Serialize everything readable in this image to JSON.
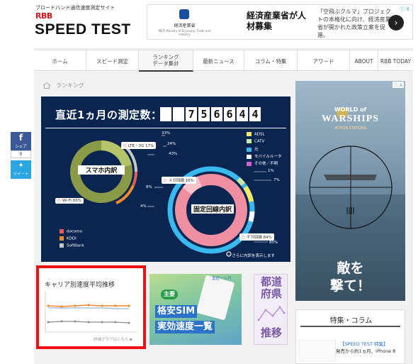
{
  "header": {
    "tagline": "ブロードバンド通信速度測定サイト",
    "logo_rbb": "RBB",
    "logo_speedtest": "SPEED TEST"
  },
  "top_ad": {
    "sponsor": "経済産業省",
    "sponsor_sub": "METI Ministry of Economy, Trade and Industry",
    "headline": "経済産業省が人材募集",
    "body": "「空飛ぶクルマ」プロジェクトの本格化に向け、経済産業省が開かれた政策立案を促進。",
    "close": "ⓘ X"
  },
  "nav": {
    "items": [
      {
        "label": "ホーム"
      },
      {
        "label": "スピード測定"
      },
      {
        "label": "ランキング\nデータ集計"
      },
      {
        "label": "最新ニュース"
      },
      {
        "label": "コラム・特集"
      },
      {
        "label": "アワード"
      },
      {
        "label": "ABOUT"
      },
      {
        "label": "RBB TODAY"
      }
    ]
  },
  "breadcrumb": {
    "home_icon": "home-icon",
    "label": "ランキング"
  },
  "share": {
    "facebook_label": "シェア",
    "facebook_count": "0",
    "twitter_label": "ツイート"
  },
  "hero": {
    "title": "直近1ヵ月の測定数：",
    "digits": [
      "",
      "",
      "7",
      "5",
      "6",
      "6",
      "4",
      "4"
    ],
    "mobile_label": "スマホ内訳",
    "fixed_label": "固定回線内訳",
    "mobile_legend": [
      {
        "label": "docomo",
        "color": "#e25d52"
      },
      {
        "label": "KDDI",
        "color": "#f28a2b"
      },
      {
        "label": "SoftBank",
        "color": "#c7c7c7"
      }
    ],
    "fixed_legend": [
      {
        "label": "ADSL",
        "color": "#f2ea66"
      },
      {
        "label": "CATV",
        "color": "#cfe6a5"
      },
      {
        "label": "光",
        "color": "#39b9ee"
      },
      {
        "label": "モバイルルータ",
        "color": "#ffffff"
      },
      {
        "label": "その他／不明",
        "color": "#d15fd6"
      }
    ],
    "mobile_pcts": {
      "p33": "33%",
      "p24": "24%",
      "p43": "43%"
    },
    "mobile_tags": {
      "lte": "LTE・3G 17%",
      "wifi": "Wi-Fi 83%"
    },
    "fixed_pcts": {
      "p1": "1%",
      "p7": "7%",
      "p8": "8%",
      "p4": "4%",
      "p80": "80%"
    },
    "fixed_tags": {
      "mega": "メガ回線 16%",
      "giga": "ギガ回線 84%"
    },
    "note": "：さらに内訳を表示します"
  },
  "speed_card": {
    "title": "キャリア別速度平均推移",
    "link": "詳細グラフはこちら ▶"
  },
  "sim_card": {
    "period": "直近一ヵ月",
    "badge": "主要",
    "line1": "格安SIM",
    "line2": "実効速度一覧"
  },
  "pref_card": {
    "top": "都道府県",
    "bottom": "推移"
  },
  "side_ad": {
    "title1": "WORLD of",
    "title2": "WARSHIPS",
    "sub": "ACTION STATIONS",
    "copy1": "敵を",
    "copy2": "撃て！",
    "close": "ⓘ X"
  },
  "feature": {
    "title": "特集・コラム",
    "item1": "【SPEED TEST 特集】",
    "item2": "発売から約1ヵ月、iPhone 8"
  },
  "colors": {
    "hero_bg": "#0a2550",
    "highlight": "#ee1111",
    "facebook": "#3b5998",
    "twitter": "#2aa7e0"
  }
}
